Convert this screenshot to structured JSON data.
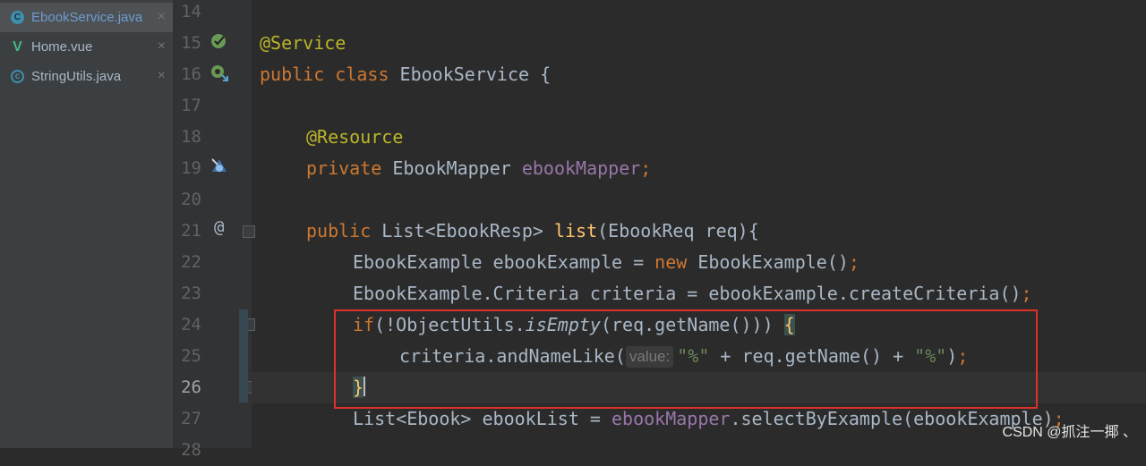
{
  "tabs": [
    {
      "label": "EbookService.java",
      "icon": "java-class-icon",
      "active": true
    },
    {
      "label": "Home.vue",
      "icon": "vue-file-icon",
      "active": false
    },
    {
      "label": "StringUtils.java",
      "icon": "java-class-icon",
      "active": false
    }
  ],
  "gutter": {
    "line_numbers": [
      "14",
      "15",
      "16",
      "17",
      "18",
      "19",
      "20",
      "21",
      "22",
      "23",
      "24",
      "25",
      "26",
      "27",
      "28"
    ],
    "current_line": "26",
    "override_marker": "@"
  },
  "code": {
    "line_15": "@Service",
    "line_16_kw1": "public",
    "line_16_kw2": "class",
    "line_16_rest": " EbookService {",
    "line_18": "@Resource",
    "line_19_kw": "private",
    "line_19_type": " EbookMapper ",
    "line_19_field": "ebookMapper",
    "line_19_semi": ";",
    "line_21_kw": "public",
    "line_21_type": " List<EbookResp> ",
    "line_21_fn": "list",
    "line_21_rest": "(EbookReq req){",
    "line_22_a": "EbookExample ebookExample = ",
    "line_22_kw": "new",
    "line_22_b": " EbookExample()",
    "line_22_semi": ";",
    "line_23_a": "EbookExample.Criteria criteria = ebookExample.createCriteria()",
    "line_23_semi": ";",
    "line_24_kw": "if",
    "line_24_a": "(!ObjectUtils.",
    "line_24_it": "isEmpty",
    "line_24_b": "(req.getName())) ",
    "line_24_brace": "{",
    "line_25_a": "criteria.andNameLike(",
    "line_25_hint": "value:",
    "line_25_str1": "\"%\"",
    "line_25_b": " + req.getName() + ",
    "line_25_str2": "\"%\"",
    "line_25_c": ")",
    "line_25_semi": ";",
    "line_26_brace": "}",
    "line_27_a": "List<Ebook> ebookList = ",
    "line_27_field": "ebookMapper",
    "line_27_b": ".selectByExample(ebookExample)",
    "line_27_semi": ";"
  },
  "watermark": "CSDN @抓注一揶 、",
  "colors": {
    "background": "#2b2b2b",
    "keyword": "#cc7832",
    "annotation": "#bbb529",
    "field": "#9876aa",
    "method": "#ffc66d",
    "string": "#6a8759",
    "highlight_box": "#e0302c"
  }
}
